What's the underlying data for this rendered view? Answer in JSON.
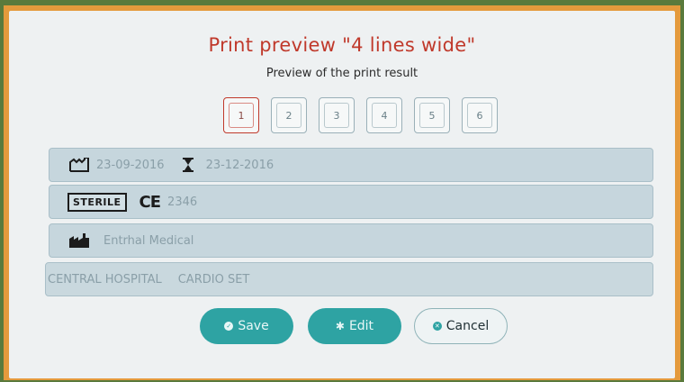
{
  "dialog": {
    "title": "Print preview \"4 lines wide\"",
    "subtitle": "Preview of the print result"
  },
  "pages": [
    "1",
    "2",
    "3",
    "4",
    "5",
    "6"
  ],
  "selected_page": "1",
  "lines": {
    "line1": {
      "manufacture_date": "23-09-2016",
      "expiry_date": "23-12-2016"
    },
    "line2": {
      "sterile_label": "STERILE",
      "ce_mark": "CE",
      "ce_number": "2346"
    },
    "line3": {
      "manufacturer": "Entrhal Medical"
    },
    "line4": {
      "hospital": "CENTRAL HOSPITAL",
      "set_name": "CARDIO SET"
    }
  },
  "buttons": {
    "save": "Save",
    "edit": "Edit",
    "cancel": "Cancel"
  },
  "colors": {
    "title": "#c0392b",
    "accent": "#2ea3a3",
    "row_bg": "#c6d6dd"
  }
}
